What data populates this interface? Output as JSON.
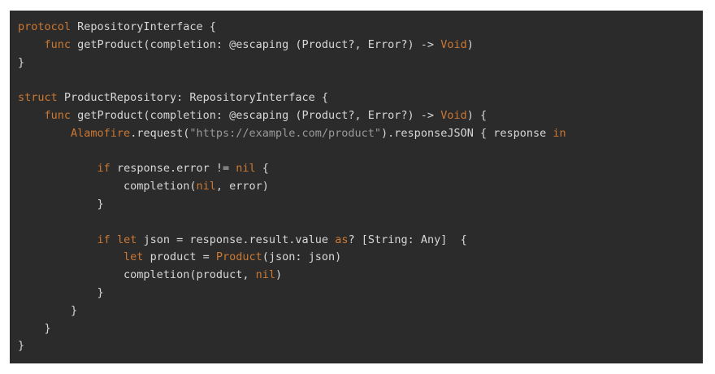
{
  "editor": {
    "language": "swift",
    "colors": {
      "background": "#2b2b2b",
      "text": "#d7d7d7",
      "keyword": "#cc7832",
      "string": "#9a9a9a"
    },
    "lines": [
      {
        "indent": "",
        "tokens": [
          {
            "t": "protocol",
            "c": "kw"
          },
          {
            "t": " RepositoryInterface {",
            "c": "plain"
          }
        ]
      },
      {
        "indent": "    ",
        "tokens": [
          {
            "t": "func",
            "c": "kw"
          },
          {
            "t": " getProduct(completion: @escaping (Product?, Error?) -> ",
            "c": "plain"
          },
          {
            "t": "Void",
            "c": "kw"
          },
          {
            "t": ")",
            "c": "plain"
          }
        ]
      },
      {
        "indent": "",
        "tokens": [
          {
            "t": "}",
            "c": "plain"
          }
        ]
      },
      {
        "indent": "",
        "tokens": []
      },
      {
        "indent": "",
        "tokens": [
          {
            "t": "struct",
            "c": "kw"
          },
          {
            "t": " ProductRepository: RepositoryInterface {",
            "c": "plain"
          }
        ]
      },
      {
        "indent": "    ",
        "tokens": [
          {
            "t": "func",
            "c": "kw"
          },
          {
            "t": " getProduct(completion: @escaping (Product?, Error?) -> ",
            "c": "plain"
          },
          {
            "t": "Void",
            "c": "kw"
          },
          {
            "t": ") {",
            "c": "plain"
          }
        ]
      },
      {
        "indent": "        ",
        "tokens": [
          {
            "t": "Alamofire",
            "c": "kw"
          },
          {
            "t": ".request(",
            "c": "plain"
          },
          {
            "t": "\"https://example.com/product\"",
            "c": "str"
          },
          {
            "t": ").responseJSON { response ",
            "c": "plain"
          },
          {
            "t": "in",
            "c": "kw"
          }
        ]
      },
      {
        "indent": "",
        "tokens": []
      },
      {
        "indent": "            ",
        "tokens": [
          {
            "t": "if",
            "c": "kw"
          },
          {
            "t": " response.error != ",
            "c": "plain"
          },
          {
            "t": "nil",
            "c": "kw"
          },
          {
            "t": " {",
            "c": "plain"
          }
        ]
      },
      {
        "indent": "                ",
        "tokens": [
          {
            "t": "completion(",
            "c": "plain"
          },
          {
            "t": "nil",
            "c": "kw"
          },
          {
            "t": ", error)",
            "c": "plain"
          }
        ]
      },
      {
        "indent": "            ",
        "tokens": [
          {
            "t": "}",
            "c": "plain"
          }
        ]
      },
      {
        "indent": "",
        "tokens": []
      },
      {
        "indent": "            ",
        "tokens": [
          {
            "t": "if",
            "c": "kw"
          },
          {
            "t": " ",
            "c": "plain"
          },
          {
            "t": "let",
            "c": "kw"
          },
          {
            "t": " json = response.result.value ",
            "c": "plain"
          },
          {
            "t": "as",
            "c": "kw"
          },
          {
            "t": "? [String: Any]  {",
            "c": "plain"
          }
        ]
      },
      {
        "indent": "                ",
        "tokens": [
          {
            "t": "let",
            "c": "kw"
          },
          {
            "t": " product = ",
            "c": "plain"
          },
          {
            "t": "Product",
            "c": "kw"
          },
          {
            "t": "(json: json)",
            "c": "plain"
          }
        ]
      },
      {
        "indent": "                ",
        "tokens": [
          {
            "t": "completion(product, ",
            "c": "plain"
          },
          {
            "t": "nil",
            "c": "kw"
          },
          {
            "t": ")",
            "c": "plain"
          }
        ]
      },
      {
        "indent": "            ",
        "tokens": [
          {
            "t": "}",
            "c": "plain"
          }
        ]
      },
      {
        "indent": "        ",
        "tokens": [
          {
            "t": "}",
            "c": "plain"
          }
        ]
      },
      {
        "indent": "    ",
        "tokens": [
          {
            "t": "}",
            "c": "plain"
          }
        ]
      },
      {
        "indent": "",
        "tokens": [
          {
            "t": "}",
            "c": "plain"
          }
        ]
      }
    ]
  }
}
